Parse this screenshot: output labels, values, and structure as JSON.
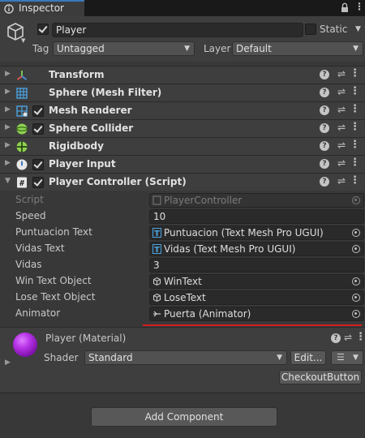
{
  "tab": {
    "title": "Inspector"
  },
  "object": {
    "name": "Player",
    "static_label": "Static",
    "tag_label": "Tag",
    "tag_value": "Untagged",
    "layer_label": "Layer",
    "layer_value": "Default"
  },
  "components": [
    {
      "title": "Transform",
      "icon": "transform-icon",
      "has_checkbox": false
    },
    {
      "title": "Sphere (Mesh Filter)",
      "icon": "mesh-filter-icon",
      "has_checkbox": false
    },
    {
      "title": "Mesh Renderer",
      "icon": "mesh-renderer-icon",
      "has_checkbox": true
    },
    {
      "title": "Sphere Collider",
      "icon": "sphere-collider-icon",
      "has_checkbox": true
    },
    {
      "title": "Rigidbody",
      "icon": "rigidbody-icon",
      "has_checkbox": false
    },
    {
      "title": "Player Input",
      "icon": "player-input-icon",
      "has_checkbox": true
    },
    {
      "title": "Player Controller (Script)",
      "icon": "script-icon",
      "has_checkbox": true
    }
  ],
  "script_props": {
    "script_label": "Script",
    "script_value": "PlayerController",
    "speed_label": "Speed",
    "speed_value": "10",
    "puntuacion_label": "Puntuacion Text",
    "puntuacion_value": "Puntuacion (Text Mesh Pro UGUI)",
    "vidas_text_label": "Vidas Text",
    "vidas_text_value": "Vidas (Text Mesh Pro UGUI)",
    "vidas_label": "Vidas",
    "vidas_value": "3",
    "win_label": "Win Text Object",
    "win_value": "WinText",
    "lose_label": "Lose Text Object",
    "lose_value": "LoseText",
    "animator_label": "Animator",
    "animator_value": "Puerta (Animator)"
  },
  "material": {
    "title": "Player (Material)",
    "shader_label": "Shader",
    "shader_value": "Standard",
    "edit_label": "Edit...",
    "checkout_label": "CheckoutButton"
  },
  "add_component_label": "Add Component",
  "colors": {
    "accent": "#3a79bb",
    "highlight_line": "#d81c1c",
    "material_sphere": "#b633e6"
  }
}
